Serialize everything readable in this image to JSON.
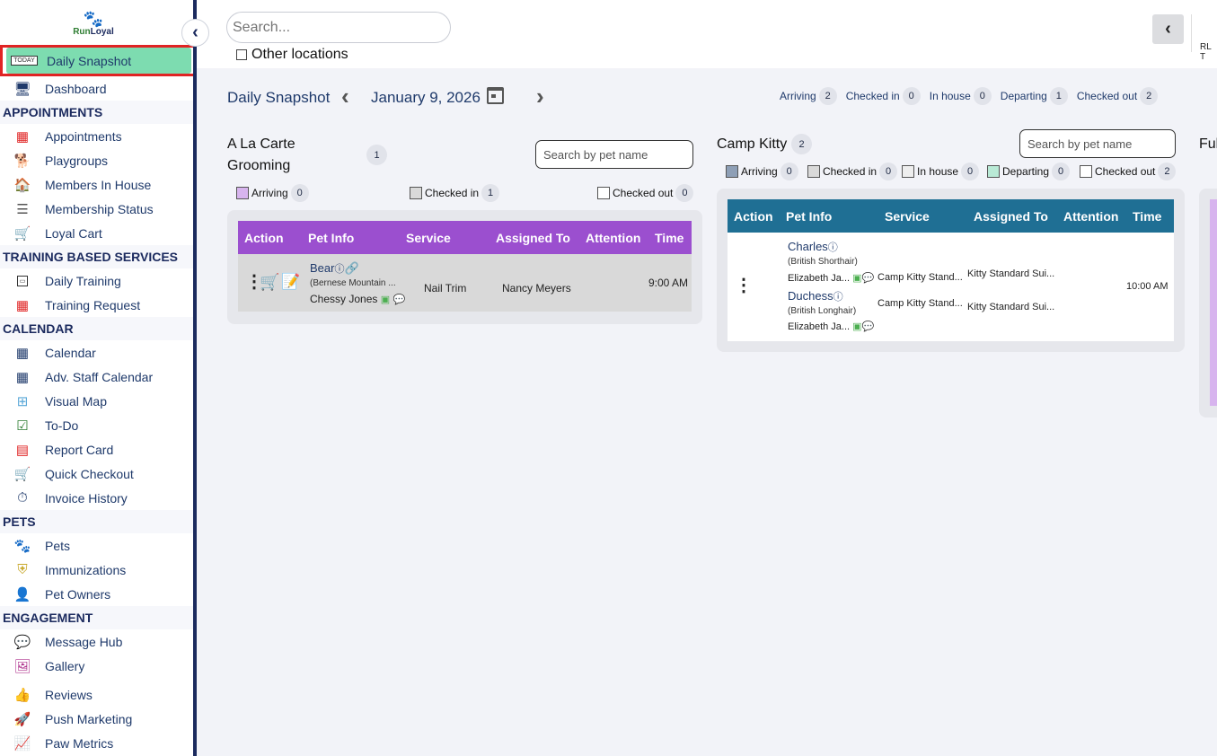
{
  "logo": {
    "text_run": "Run",
    "text_loyal": "Loyal"
  },
  "sidebar": {
    "active": {
      "label": "Daily Snapshot",
      "badge": "TODAY"
    },
    "items_top": [
      {
        "label": "Dashboard"
      }
    ],
    "sections": [
      {
        "heading": "APPOINTMENTS",
        "items": [
          "Appointments",
          "Playgroups",
          "Members In House",
          "Membership Status",
          "Loyal Cart"
        ]
      },
      {
        "heading": "TRAINING BASED SERVICES",
        "items": [
          "Daily Training",
          "Training Request"
        ]
      },
      {
        "heading": "CALENDAR",
        "items": [
          "Calendar",
          "Adv. Staff Calendar",
          "Visual Map",
          "To-Do",
          "Report Card",
          "Quick Checkout",
          "Invoice History"
        ]
      },
      {
        "heading": "PETS",
        "items": [
          "Pets",
          "Immunizations",
          "Pet Owners"
        ]
      },
      {
        "heading": "ENGAGEMENT",
        "items": [
          "Message Hub",
          "Gallery",
          "Reviews",
          "Push Marketing",
          "Paw Metrics"
        ]
      }
    ]
  },
  "topbar": {
    "search_placeholder": "Search...",
    "other_locations": "Other locations",
    "user_tag": "RL T"
  },
  "header": {
    "title": "Daily Snapshot",
    "date": "January 9, 2026",
    "stats": [
      {
        "label": "Arriving",
        "count": "2"
      },
      {
        "label": "Checked in",
        "count": "0"
      },
      {
        "label": "In house",
        "count": "0"
      },
      {
        "label": "Departing",
        "count": "1"
      },
      {
        "label": "Checked out",
        "count": "2"
      }
    ]
  },
  "grooming": {
    "title_line1": "A La Carte",
    "title_line2": "Grooming",
    "count": "1",
    "search_placeholder": "Search by pet name",
    "legend": [
      {
        "label": "Arriving",
        "count": "0",
        "color": "#d7b4ee"
      },
      {
        "label": "Checked in",
        "count": "1",
        "color": "#d9d9d9"
      },
      {
        "label": "Checked out",
        "count": "0",
        "color": "#ffffff"
      }
    ],
    "header_color": "#9b4fcf",
    "columns": [
      "Action",
      "Pet Info",
      "Service",
      "Assigned To",
      "Attention",
      "Time"
    ],
    "row": {
      "pet": "Bear",
      "breed": "(Bernese Mountain ...",
      "owner": "Chessy Jones",
      "service": "Nail Trim",
      "assigned": "Nancy Meyers",
      "time": "9:00 AM"
    }
  },
  "kitty": {
    "title": "Camp Kitty",
    "count": "2",
    "search_placeholder": "Search by pet name",
    "legend": [
      {
        "label": "Arriving",
        "count": "0",
        "color": "#8e9fb6"
      },
      {
        "label": "Checked in",
        "count": "0",
        "color": "#d9d9d9"
      },
      {
        "label": "In house",
        "count": "0",
        "color": "#eeeeee"
      },
      {
        "label": "Departing",
        "count": "0",
        "color": "#b9ead6"
      },
      {
        "label": "Checked out",
        "count": "2",
        "color": "#ffffff"
      }
    ],
    "header_color": "#1f6f94",
    "columns": [
      "Action",
      "Pet Info",
      "Service",
      "Assigned To",
      "Attention",
      "Time"
    ],
    "rows": [
      {
        "pet": "Charles",
        "breed": "(British Shorthair)",
        "owner": "Elizabeth Ja...",
        "service": "Camp Kitty Stand...",
        "assigned": "Kitty Standard Sui..."
      },
      {
        "pet": "Duchess",
        "breed": "(British Longhair)",
        "owner": "Elizabeth Ja...",
        "service": "Camp Kitty Stand...",
        "assigned": "Kitty Standard Sui..."
      }
    ],
    "time": "10:00 AM"
  },
  "third_card_title": "Ful"
}
